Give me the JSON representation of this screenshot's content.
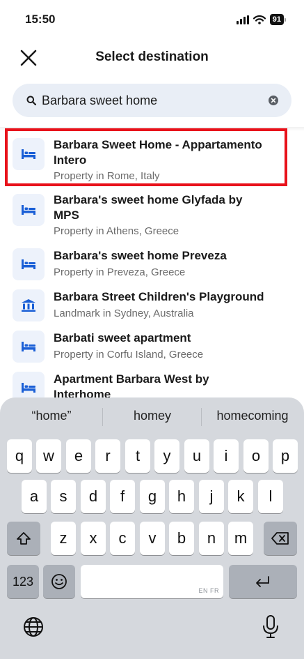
{
  "status": {
    "time": "15:50",
    "battery": "91"
  },
  "header": {
    "title": "Select destination"
  },
  "search": {
    "value": "Barbara sweet home",
    "placeholder": ""
  },
  "results": [
    {
      "title": "Barbara Sweet Home - Appartamento Intero",
      "subtitle": "Property in Rome, Italy",
      "icon": "bed-icon"
    },
    {
      "title": "Barbara's sweet home Glyfada by MPS",
      "subtitle": "Property in Athens, Greece",
      "icon": "bed-icon"
    },
    {
      "title": "Barbara's sweet home Preveza",
      "subtitle": "Property in Preveza, Greece",
      "icon": "bed-icon"
    },
    {
      "title": "Barbara Street Children's Playground",
      "subtitle": "Landmark in Sydney, Australia",
      "icon": "landmark-icon"
    },
    {
      "title": "Barbati sweet apartment",
      "subtitle": "Property in Corfu Island, Greece",
      "icon": "bed-icon"
    },
    {
      "title": "Apartment Barbara West by Interhome",
      "subtitle": "",
      "icon": "bed-icon"
    }
  ],
  "keyboard": {
    "suggestions": [
      "“home”",
      "homey",
      "homecoming"
    ],
    "row1": [
      "q",
      "w",
      "e",
      "r",
      "t",
      "y",
      "u",
      "i",
      "o",
      "p"
    ],
    "row2": [
      "a",
      "s",
      "d",
      "f",
      "g",
      "h",
      "j",
      "k",
      "l"
    ],
    "row3": [
      "z",
      "x",
      "c",
      "v",
      "b",
      "n",
      "m"
    ],
    "numbers_label": "123",
    "space_language": "EN FR"
  },
  "colors": {
    "accent": "#1a5fd6",
    "highlight": "#e8121b",
    "icon_bg": "#edf2fb"
  }
}
